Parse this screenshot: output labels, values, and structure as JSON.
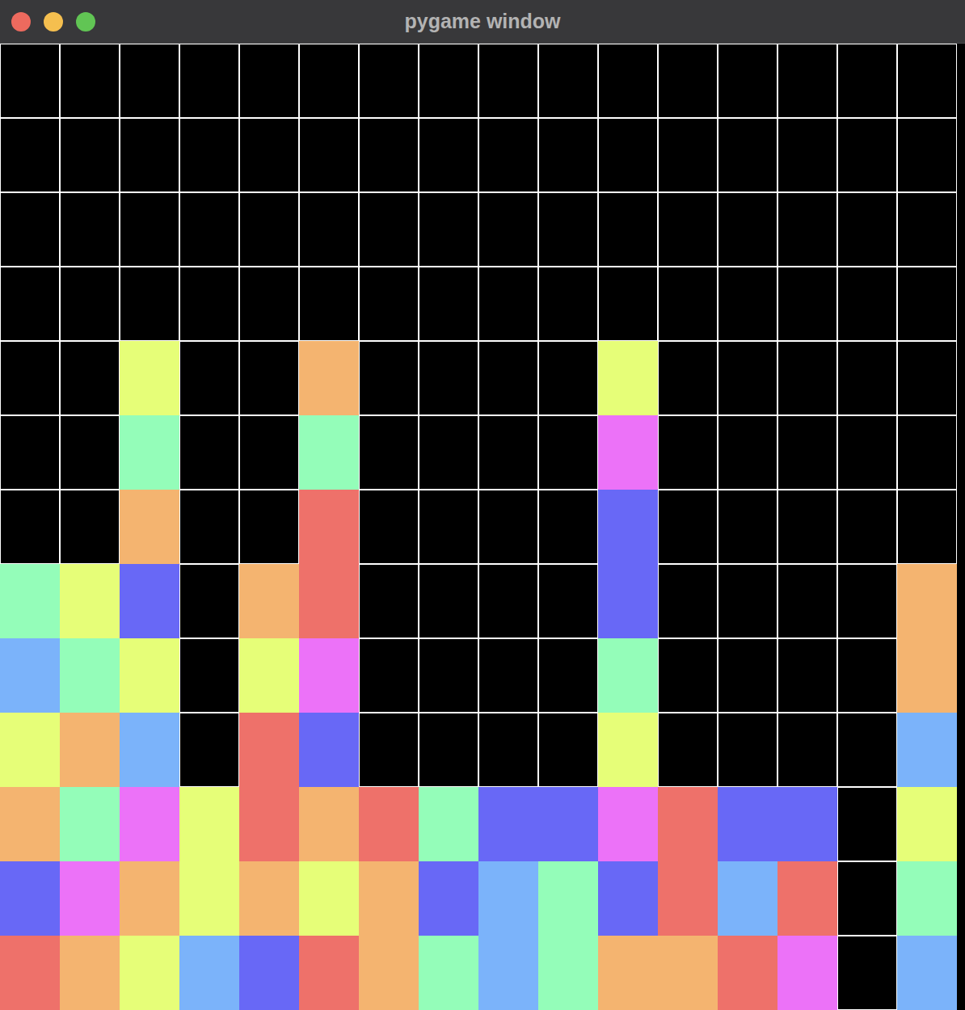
{
  "window": {
    "title": "pygame window"
  },
  "board": {
    "rows": [
      [
        {
          "filled": false
        },
        {
          "filled": false
        },
        {
          "filled": false
        },
        {
          "filled": false
        },
        {
          "filled": false
        },
        {
          "filled": false
        },
        {
          "filled": false
        },
        {
          "filled": false
        },
        {
          "filled": false
        },
        {
          "filled": false
        },
        {
          "filled": false
        },
        {
          "filled": false
        },
        {
          "filled": false
        },
        {
          "filled": false
        },
        {
          "filled": false
        },
        {
          "filled": false
        }
      ],
      [
        {
          "filled": false
        },
        {
          "filled": false
        },
        {
          "filled": false
        },
        {
          "filled": false
        },
        {
          "filled": false
        },
        {
          "filled": false
        },
        {
          "filled": false
        },
        {
          "filled": false
        },
        {
          "filled": false
        },
        {
          "filled": false
        },
        {
          "filled": false
        },
        {
          "filled": false
        },
        {
          "filled": false
        },
        {
          "filled": false
        },
        {
          "filled": false
        },
        {
          "filled": false
        }
      ],
      [
        {
          "filled": false
        },
        {
          "filled": false
        },
        {
          "filled": false
        },
        {
          "filled": false
        },
        {
          "filled": false
        },
        {
          "filled": false
        },
        {
          "filled": false
        },
        {
          "filled": false
        },
        {
          "filled": false
        },
        {
          "filled": false
        },
        {
          "filled": false
        },
        {
          "filled": false
        },
        {
          "filled": false
        },
        {
          "filled": false
        },
        {
          "filled": false
        },
        {
          "filled": false
        }
      ],
      [
        {
          "filled": false
        },
        {
          "filled": false
        },
        {
          "filled": false
        },
        {
          "filled": false
        },
        {
          "filled": false
        },
        {
          "filled": false
        },
        {
          "filled": false
        },
        {
          "filled": false
        },
        {
          "filled": false
        },
        {
          "filled": false
        },
        {
          "filled": false
        },
        {
          "filled": false
        },
        {
          "filled": false
        },
        {
          "filled": false
        },
        {
          "filled": false
        },
        {
          "filled": false
        }
      ],
      [
        {
          "filled": false
        },
        {
          "filled": false
        },
        {
          "filled": true,
          "color": "#e6fe78"
        },
        {
          "filled": false
        },
        {
          "filled": false
        },
        {
          "filled": true,
          "color": "#f4b470"
        },
        {
          "filled": false
        },
        {
          "filled": false
        },
        {
          "filled": false
        },
        {
          "filled": false
        },
        {
          "filled": true,
          "color": "#e6fe78"
        },
        {
          "filled": false
        },
        {
          "filled": false
        },
        {
          "filled": false
        },
        {
          "filled": false
        },
        {
          "filled": false
        }
      ],
      [
        {
          "filled": false
        },
        {
          "filled": false
        },
        {
          "filled": true,
          "color": "#94fdb9"
        },
        {
          "filled": false
        },
        {
          "filled": false
        },
        {
          "filled": true,
          "color": "#94fdb9"
        },
        {
          "filled": false
        },
        {
          "filled": false
        },
        {
          "filled": false
        },
        {
          "filled": false
        },
        {
          "filled": true,
          "color": "#ec72f8"
        },
        {
          "filled": false
        },
        {
          "filled": false
        },
        {
          "filled": false
        },
        {
          "filled": false
        },
        {
          "filled": false
        }
      ],
      [
        {
          "filled": false
        },
        {
          "filled": false
        },
        {
          "filled": true,
          "color": "#f4b470"
        },
        {
          "filled": false
        },
        {
          "filled": false
        },
        {
          "filled": true,
          "color": "#ee716a"
        },
        {
          "filled": false
        },
        {
          "filled": false
        },
        {
          "filled": false
        },
        {
          "filled": false
        },
        {
          "filled": true,
          "color": "#6868f6"
        },
        {
          "filled": false
        },
        {
          "filled": false
        },
        {
          "filled": false
        },
        {
          "filled": false
        },
        {
          "filled": false
        }
      ],
      [
        {
          "filled": true,
          "color": "#94fdb9"
        },
        {
          "filled": true,
          "color": "#e6fe78"
        },
        {
          "filled": true,
          "color": "#6868f6"
        },
        {
          "filled": false
        },
        {
          "filled": true,
          "color": "#f4b470"
        },
        {
          "filled": true,
          "color": "#ee716a"
        },
        {
          "filled": false
        },
        {
          "filled": false
        },
        {
          "filled": false
        },
        {
          "filled": false
        },
        {
          "filled": true,
          "color": "#6868f6"
        },
        {
          "filled": false
        },
        {
          "filled": false
        },
        {
          "filled": false
        },
        {
          "filled": false
        },
        {
          "filled": true,
          "color": "#f4b470"
        }
      ],
      [
        {
          "filled": true,
          "color": "#7bb3fa"
        },
        {
          "filled": true,
          "color": "#94fdb9"
        },
        {
          "filled": true,
          "color": "#e6fe78"
        },
        {
          "filled": false
        },
        {
          "filled": true,
          "color": "#e6fe78"
        },
        {
          "filled": true,
          "color": "#ec72f8"
        },
        {
          "filled": false
        },
        {
          "filled": false
        },
        {
          "filled": false
        },
        {
          "filled": false
        },
        {
          "filled": true,
          "color": "#94fdb9"
        },
        {
          "filled": false
        },
        {
          "filled": false
        },
        {
          "filled": false
        },
        {
          "filled": false
        },
        {
          "filled": true,
          "color": "#f4b470"
        }
      ],
      [
        {
          "filled": true,
          "color": "#e6fe78"
        },
        {
          "filled": true,
          "color": "#f4b470"
        },
        {
          "filled": true,
          "color": "#7bb3fa"
        },
        {
          "filled": false
        },
        {
          "filled": true,
          "color": "#ee716a"
        },
        {
          "filled": true,
          "color": "#6868f6"
        },
        {
          "filled": false
        },
        {
          "filled": false
        },
        {
          "filled": false
        },
        {
          "filled": false
        },
        {
          "filled": true,
          "color": "#e6fe78"
        },
        {
          "filled": false
        },
        {
          "filled": false
        },
        {
          "filled": false
        },
        {
          "filled": false
        },
        {
          "filled": true,
          "color": "#7bb3fa"
        }
      ],
      [
        {
          "filled": true,
          "color": "#f4b470"
        },
        {
          "filled": true,
          "color": "#94fdb9"
        },
        {
          "filled": true,
          "color": "#ec72f8"
        },
        {
          "filled": true,
          "color": "#e6fe78"
        },
        {
          "filled": true,
          "color": "#ee716a"
        },
        {
          "filled": true,
          "color": "#f4b470"
        },
        {
          "filled": true,
          "color": "#ee716a"
        },
        {
          "filled": true,
          "color": "#94fdb9"
        },
        {
          "filled": true,
          "color": "#6868f6"
        },
        {
          "filled": true,
          "color": "#6868f6"
        },
        {
          "filled": true,
          "color": "#ec72f8"
        },
        {
          "filled": true,
          "color": "#ee716a"
        },
        {
          "filled": true,
          "color": "#6868f6"
        },
        {
          "filled": true,
          "color": "#6868f6"
        },
        {
          "filled": false
        },
        {
          "filled": true,
          "color": "#e6fe78"
        }
      ],
      [
        {
          "filled": true,
          "color": "#6868f6"
        },
        {
          "filled": true,
          "color": "#ec72f8"
        },
        {
          "filled": true,
          "color": "#f4b470"
        },
        {
          "filled": true,
          "color": "#e6fe78"
        },
        {
          "filled": true,
          "color": "#f4b470"
        },
        {
          "filled": true,
          "color": "#e6fe78"
        },
        {
          "filled": true,
          "color": "#f4b470"
        },
        {
          "filled": true,
          "color": "#6868f6"
        },
        {
          "filled": true,
          "color": "#7bb3fa"
        },
        {
          "filled": true,
          "color": "#94fdb9"
        },
        {
          "filled": true,
          "color": "#6868f6"
        },
        {
          "filled": true,
          "color": "#ee716a"
        },
        {
          "filled": true,
          "color": "#7bb3fa"
        },
        {
          "filled": true,
          "color": "#ee716a"
        },
        {
          "filled": false
        },
        {
          "filled": true,
          "color": "#94fdb9"
        }
      ],
      [
        {
          "filled": true,
          "color": "#ee716a"
        },
        {
          "filled": true,
          "color": "#f4b470"
        },
        {
          "filled": true,
          "color": "#e6fe78"
        },
        {
          "filled": true,
          "color": "#7bb3fa"
        },
        {
          "filled": true,
          "color": "#6868f6"
        },
        {
          "filled": true,
          "color": "#ee716a"
        },
        {
          "filled": true,
          "color": "#f4b470"
        },
        {
          "filled": true,
          "color": "#94fdb9"
        },
        {
          "filled": true,
          "color": "#7bb3fa"
        },
        {
          "filled": true,
          "color": "#94fdb9"
        },
        {
          "filled": true,
          "color": "#f4b470"
        },
        {
          "filled": true,
          "color": "#f4b470"
        },
        {
          "filled": true,
          "color": "#ee716a"
        },
        {
          "filled": true,
          "color": "#ec72f8"
        },
        {
          "filled": false
        },
        {
          "filled": true,
          "color": "#7bb3fa"
        }
      ]
    ]
  }
}
